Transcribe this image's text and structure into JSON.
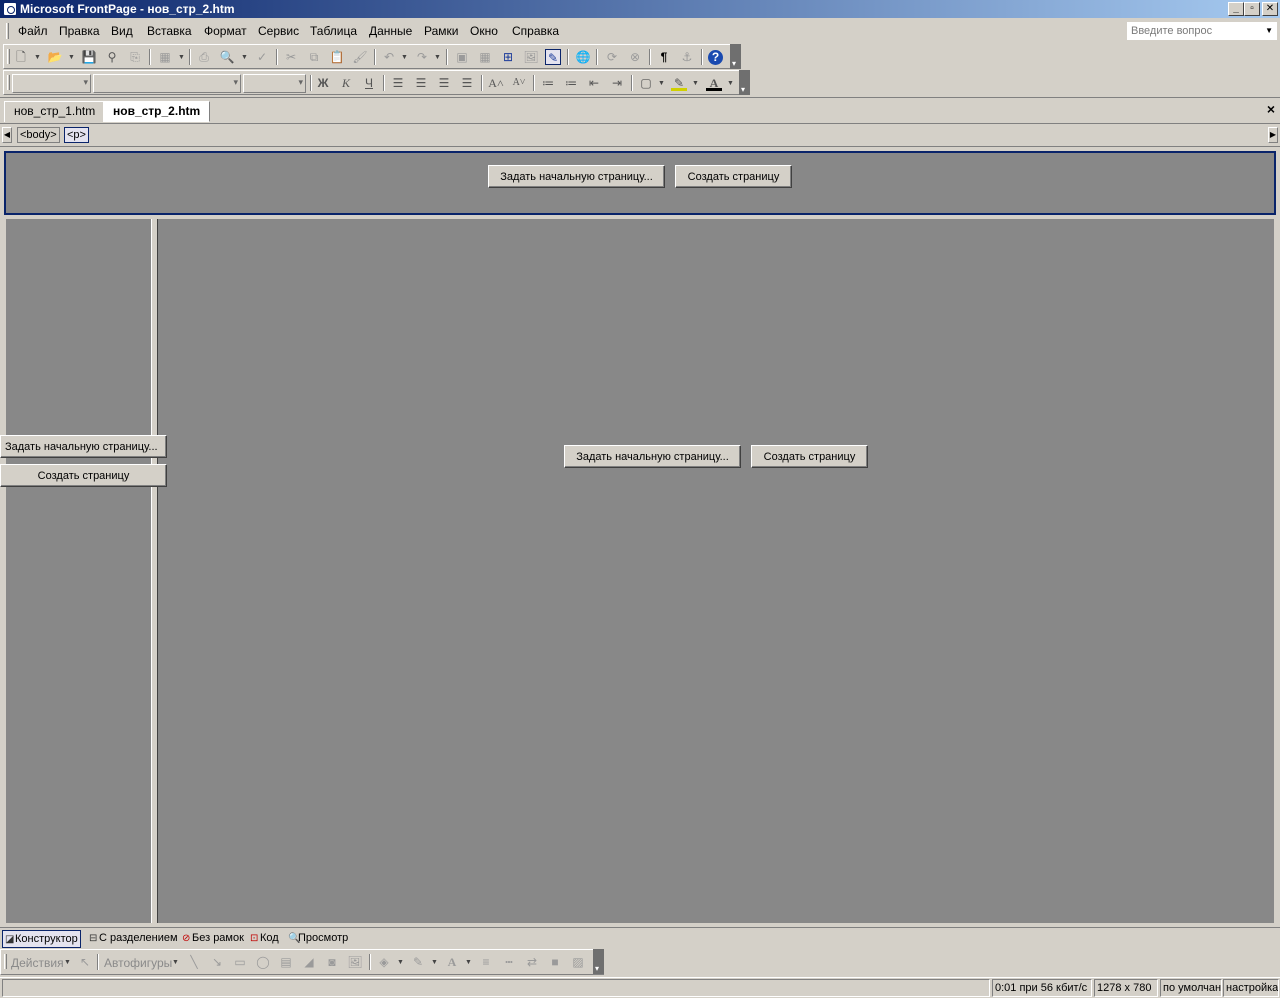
{
  "window": {
    "title": "Microsoft FrontPage - нов_стр_2.htm",
    "controls": [
      "_",
      "▫",
      "✕"
    ]
  },
  "menu": {
    "items": [
      "Файл",
      "Правка",
      "Вид",
      "Вставка",
      "Формат",
      "Сервис",
      "Таблица",
      "Данные",
      "Рамки",
      "Окно",
      "Справка"
    ],
    "question_placeholder": "Введите вопрос"
  },
  "formatting": {
    "bold": "Ж",
    "italic": "К",
    "underline": "Ч"
  },
  "document_tabs": {
    "tabs": [
      {
        "label": "нов_стр_1.htm",
        "active": false
      },
      {
        "label": "нов_стр_2.htm",
        "active": true
      }
    ],
    "close": "×"
  },
  "tag_selector": {
    "tags": [
      "<body>",
      "<p>"
    ]
  },
  "frames": {
    "top": {
      "set_initial_page": "Задать начальную страницу...",
      "new_page": "Создать страницу"
    },
    "left": {
      "set_initial_page": "Задать начальную страницу...",
      "new_page": "Создать страницу"
    },
    "main": {
      "set_initial_page": "Задать начальную страницу...",
      "new_page": "Создать страницу"
    }
  },
  "view_tabs": [
    "Конструктор",
    "С разделением",
    "Без рамок",
    "Код",
    "Просмотр"
  ],
  "drawing_toolbar": {
    "actions": "Действия",
    "autoshapes": "Автофигуры"
  },
  "status": {
    "download_time": "0:01 при 56 кбит/с",
    "resolution": "1278 x 780",
    "mode": "по умолчанию",
    "settings": "настройка"
  },
  "colors": {
    "title_bar_start": "#0a246a",
    "title_bar_end": "#a6caf0",
    "frame_background": "#888888",
    "chrome": "#d4d0c8",
    "selected_frame_border": "#0a246a"
  }
}
